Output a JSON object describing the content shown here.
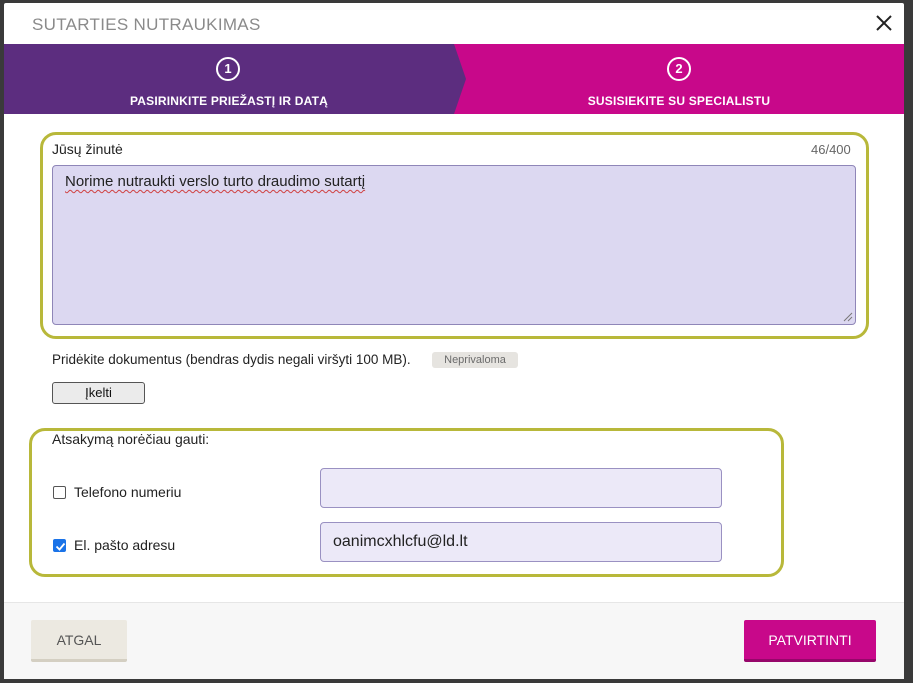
{
  "dialog": {
    "title": "SUTARTIES NUTRAUKIMAS",
    "close_icon": "close-icon"
  },
  "stepper": {
    "colors": {
      "active": "#5c2d7f",
      "inactive": "#c8088a"
    },
    "steps": [
      {
        "number": "1",
        "label": "PASIRINKITE PRIEŽASTĮ IR DATĄ"
      },
      {
        "number": "2",
        "label": "SUSISIEKITE SU SPECIALISTU"
      }
    ]
  },
  "message": {
    "label": "Jūsų žinutė",
    "counter": "46/400",
    "value": "Norime nutraukti verslo turto draudimo sutartį"
  },
  "attachments": {
    "label": "Pridėkite dokumentus (bendras dydis negali viršyti 100 MB).",
    "optional_badge": "Neprivaloma",
    "upload_label": "Įkelti"
  },
  "reply": {
    "heading": "Atsakymą norėčiau gauti:",
    "phone": {
      "label": "Telefono numeriu",
      "checked": false,
      "value": ""
    },
    "email": {
      "label": "El. pašto adresu",
      "checked": true,
      "value": "oanimcxhlcfu@ld.lt"
    }
  },
  "footer": {
    "back_label": "ATGAL",
    "confirm_label": "PATVIRTINTI"
  },
  "colors": {
    "accent": "#c8088a",
    "step_active": "#5c2d7f",
    "highlight": "#b8b83a",
    "field_bg": "#dcd8f1"
  }
}
